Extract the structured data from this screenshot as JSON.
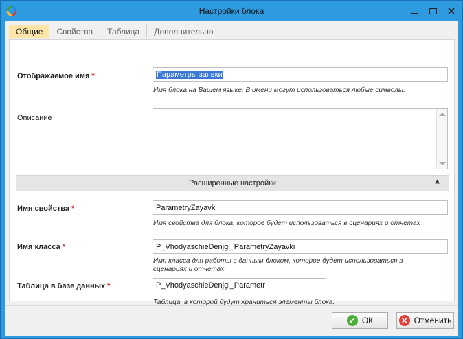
{
  "window": {
    "title": "Настройки блока",
    "accent": "#2e9ae0"
  },
  "tabs": [
    {
      "label": "Общие",
      "active": true
    },
    {
      "label": "Свойства",
      "active": false
    },
    {
      "label": "Таблица",
      "active": false
    },
    {
      "label": "Дополнительно",
      "active": false
    }
  ],
  "form": {
    "display_name": {
      "label": "Отображаемое имя",
      "required": "*",
      "value": "Параметры заявки",
      "hint": "Имя блока на Вашем языке. В имени могут использоваться любые символы."
    },
    "description": {
      "label": "Описание",
      "value": ""
    },
    "advanced": {
      "label": "Расширенные настройки",
      "icon": "double-chevron-up-icon"
    },
    "property_name": {
      "label": "Имя свойства",
      "required": "*",
      "value": "ParametryZayavki",
      "hint": "Имя свойства для блока, которое будет использоваться в сценариях и отчетах"
    },
    "class_name": {
      "label": "Имя класса",
      "required": "*",
      "value": "P_VhodyaschieDenjgi_ParametryZayavki",
      "hint": "Имя класса для работы с данным блоком, которое будет использоваться в сценариях и отчетах"
    },
    "db_table": {
      "label": "Таблица в базе данных",
      "required": "*",
      "value": "P_VhodyaschieDenjgi_Parametr",
      "hint": "Таблица, в которой будут храниться элементы блока."
    }
  },
  "buttons": {
    "ok": "ОК",
    "cancel": "Отменить"
  }
}
